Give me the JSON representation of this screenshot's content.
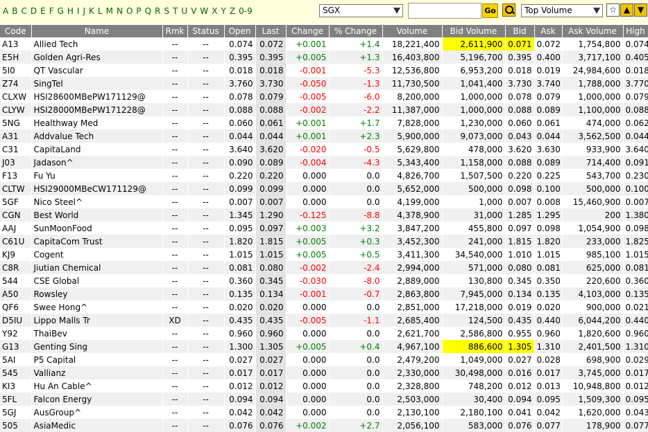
{
  "letters": [
    "A",
    "B",
    "C",
    "D",
    "E",
    "F",
    "G",
    "H",
    "I",
    "J",
    "K",
    "L",
    "M",
    "N",
    "O",
    "P",
    "Q",
    "R",
    "S",
    "T",
    "U",
    "V",
    "W",
    "X",
    "Y",
    "Z",
    "0-9"
  ],
  "exchange": "SGX",
  "search_value": "",
  "go_label": "Go",
  "sort_select": "Top Volume",
  "colors": {
    "header_bg": "#808080",
    "up": "#008000",
    "down": "#ff0000",
    "highlight": "#ffff00",
    "topbar_bg": "#ffffdd"
  },
  "columns": [
    "Code",
    "Name",
    "Rmk",
    "Status",
    "Open",
    "Last",
    "Change",
    "% Change",
    "Volume",
    "Bid Volume",
    "Bid",
    "Ask",
    "Ask Volume",
    "High"
  ],
  "rows": [
    {
      "code": "A13",
      "name": "Allied Tech",
      "rmk": "--",
      "status": "--",
      "open": "0.074",
      "last": "0.072",
      "change": "+0.001",
      "pct": "+1.4",
      "volume": "18,221,400",
      "bidvol": "2,611,900",
      "bid": "0.071",
      "ask": "0.072",
      "askvol": "1,754,800",
      "high": "0.074",
      "dir": "up",
      "hl": true
    },
    {
      "code": "E5H",
      "name": "Golden Agri-Res",
      "rmk": "--",
      "status": "--",
      "open": "0.395",
      "last": "0.395",
      "change": "+0.005",
      "pct": "+1.3",
      "volume": "16,403,800",
      "bidvol": "5,196,700",
      "bid": "0.395",
      "ask": "0.400",
      "askvol": "3,717,100",
      "high": "0.405",
      "dir": "up",
      "hl": false
    },
    {
      "code": "5I0",
      "name": "QT Vascular",
      "rmk": "--",
      "status": "--",
      "open": "0.018",
      "last": "0.018",
      "change": "-0.001",
      "pct": "-5.3",
      "volume": "12,536,800",
      "bidvol": "6,953,200",
      "bid": "0.018",
      "ask": "0.019",
      "askvol": "24,984,600",
      "high": "0.018",
      "dir": "dn",
      "hl": false
    },
    {
      "code": "Z74",
      "name": "SingTel",
      "rmk": "--",
      "status": "--",
      "open": "3.760",
      "last": "3.730",
      "change": "-0.050",
      "pct": "-1.3",
      "volume": "11,730,500",
      "bidvol": "1,041,400",
      "bid": "3.730",
      "ask": "3.740",
      "askvol": "1,788,000",
      "high": "3.770",
      "dir": "dn",
      "hl": false
    },
    {
      "code": "CLXW",
      "name": "HSI28600MBePW171129@",
      "rmk": "--",
      "status": "--",
      "open": "0.078",
      "last": "0.079",
      "change": "-0.005",
      "pct": "-6.0",
      "volume": "8,200,000",
      "bidvol": "1,000,000",
      "bid": "0.078",
      "ask": "0.079",
      "askvol": "1,000,000",
      "high": "0.079",
      "dir": "dn",
      "hl": false
    },
    {
      "code": "CLYW",
      "name": "HSI28000MBePW171228@",
      "rmk": "--",
      "status": "--",
      "open": "0.088",
      "last": "0.088",
      "change": "-0.002",
      "pct": "-2.2",
      "volume": "11,387,000",
      "bidvol": "1,000,000",
      "bid": "0.088",
      "ask": "0.089",
      "askvol": "1,100,000",
      "high": "0.088",
      "dir": "dn",
      "hl": false
    },
    {
      "code": "5NG",
      "name": "Healthway Med",
      "rmk": "--",
      "status": "--",
      "open": "0.060",
      "last": "0.061",
      "change": "+0.001",
      "pct": "+1.7",
      "volume": "7,828,000",
      "bidvol": "1,230,000",
      "bid": "0.060",
      "ask": "0.061",
      "askvol": "474,000",
      "high": "0.062",
      "dir": "up",
      "hl": false
    },
    {
      "code": "A31",
      "name": "Addvalue Tech",
      "rmk": "--",
      "status": "--",
      "open": "0.044",
      "last": "0.044",
      "change": "+0.001",
      "pct": "+2.3",
      "volume": "5,900,000",
      "bidvol": "9,073,000",
      "bid": "0.043",
      "ask": "0.044",
      "askvol": "3,562,500",
      "high": "0.044",
      "dir": "up",
      "hl": false
    },
    {
      "code": "C31",
      "name": "CapitaLand",
      "rmk": "--",
      "status": "--",
      "open": "3.640",
      "last": "3.620",
      "change": "-0.020",
      "pct": "-0.5",
      "volume": "5,629,800",
      "bidvol": "478,000",
      "bid": "3.620",
      "ask": "3.630",
      "askvol": "933,900",
      "high": "3.640",
      "dir": "dn",
      "hl": false
    },
    {
      "code": "J03",
      "name": "Jadason^",
      "rmk": "--",
      "status": "--",
      "open": "0.090",
      "last": "0.089",
      "change": "-0.004",
      "pct": "-4.3",
      "volume": "5,343,400",
      "bidvol": "1,158,000",
      "bid": "0.088",
      "ask": "0.089",
      "askvol": "714,400",
      "high": "0.091",
      "dir": "dn",
      "hl": false
    },
    {
      "code": "F13",
      "name": "Fu Yu",
      "rmk": "--",
      "status": "--",
      "open": "0.220",
      "last": "0.220",
      "change": "0.000",
      "pct": "0.0",
      "volume": "4,826,700",
      "bidvol": "1,507,500",
      "bid": "0.220",
      "ask": "0.225",
      "askvol": "543,700",
      "high": "0.230",
      "dir": "nc",
      "hl": false
    },
    {
      "code": "CLTW",
      "name": "HSI29000MBeCW171129@",
      "rmk": "--",
      "status": "--",
      "open": "0.099",
      "last": "0.099",
      "change": "0.000",
      "pct": "0.0",
      "volume": "5,652,000",
      "bidvol": "500,000",
      "bid": "0.098",
      "ask": "0.100",
      "askvol": "500,000",
      "high": "0.100",
      "dir": "nc",
      "hl": false
    },
    {
      "code": "5GF",
      "name": "Nico Steel^",
      "rmk": "--",
      "status": "--",
      "open": "0.007",
      "last": "0.007",
      "change": "0.000",
      "pct": "0.0",
      "volume": "4,199,000",
      "bidvol": "1,000",
      "bid": "0.007",
      "ask": "0.008",
      "askvol": "15,460,900",
      "high": "0.007",
      "dir": "nc",
      "hl": false
    },
    {
      "code": "CGN",
      "name": "Best World",
      "rmk": "--",
      "status": "--",
      "open": "1.345",
      "last": "1.290",
      "change": "-0.125",
      "pct": "-8.8",
      "volume": "4,378,900",
      "bidvol": "31,000",
      "bid": "1.285",
      "ask": "1.295",
      "askvol": "200",
      "high": "1.380",
      "dir": "dn",
      "hl": false
    },
    {
      "code": "AAJ",
      "name": "SunMoonFood",
      "rmk": "--",
      "status": "--",
      "open": "0.095",
      "last": "0.097",
      "change": "+0.003",
      "pct": "+3.2",
      "volume": "3,847,200",
      "bidvol": "455,800",
      "bid": "0.097",
      "ask": "0.098",
      "askvol": "1,054,900",
      "high": "0.098",
      "dir": "up",
      "hl": false
    },
    {
      "code": "C61U",
      "name": "CapitaCom Trust",
      "rmk": "--",
      "status": "--",
      "open": "1.820",
      "last": "1.815",
      "change": "+0.005",
      "pct": "+0.3",
      "volume": "3,452,300",
      "bidvol": "241,000",
      "bid": "1.815",
      "ask": "1.820",
      "askvol": "233,000",
      "high": "1.825",
      "dir": "up",
      "hl": false
    },
    {
      "code": "KJ9",
      "name": "Cogent",
      "rmk": "--",
      "status": "--",
      "open": "1.015",
      "last": "1.015",
      "change": "+0.005",
      "pct": "+0.5",
      "volume": "3,411,300",
      "bidvol": "34,540,000",
      "bid": "1.010",
      "ask": "1.015",
      "askvol": "985,100",
      "high": "1.015",
      "dir": "up",
      "hl": false
    },
    {
      "code": "C8R",
      "name": "Jiutian Chemical",
      "rmk": "--",
      "status": "--",
      "open": "0.081",
      "last": "0.080",
      "change": "-0.002",
      "pct": "-2.4",
      "volume": "2,994,000",
      "bidvol": "571,000",
      "bid": "0.080",
      "ask": "0.081",
      "askvol": "625,000",
      "high": "0.081",
      "dir": "dn",
      "hl": false
    },
    {
      "code": "544",
      "name": "CSE Global",
      "rmk": "--",
      "status": "--",
      "open": "0.360",
      "last": "0.345",
      "change": "-0.030",
      "pct": "-8.0",
      "volume": "2,889,000",
      "bidvol": "130,800",
      "bid": "0.345",
      "ask": "0.350",
      "askvol": "220,600",
      "high": "0.360",
      "dir": "dn",
      "hl": false
    },
    {
      "code": "A50",
      "name": "Rowsley",
      "rmk": "--",
      "status": "--",
      "open": "0.135",
      "last": "0.134",
      "change": "-0.001",
      "pct": "-0.7",
      "volume": "2,863,800",
      "bidvol": "7,945,000",
      "bid": "0.134",
      "ask": "0.135",
      "askvol": "4,103,000",
      "high": "0.135",
      "dir": "dn",
      "hl": false
    },
    {
      "code": "QF6",
      "name": "Swee Hong^",
      "rmk": "--",
      "status": "--",
      "open": "0.020",
      "last": "0.020",
      "change": "0.000",
      "pct": "0.0",
      "volume": "2,851,000",
      "bidvol": "17,218,000",
      "bid": "0.019",
      "ask": "0.020",
      "askvol": "900,000",
      "high": "0.021",
      "dir": "nc",
      "hl": false
    },
    {
      "code": "D5IU",
      "name": "Lippo Malls Tr",
      "rmk": "XD",
      "status": "--",
      "open": "0.435",
      "last": "0.435",
      "change": "-0.005",
      "pct": "-1.1",
      "volume": "2,685,400",
      "bidvol": "124,500",
      "bid": "0.435",
      "ask": "0.440",
      "askvol": "6,044,200",
      "high": "0.440",
      "dir": "dn",
      "hl": false
    },
    {
      "code": "Y92",
      "name": "ThaiBev",
      "rmk": "--",
      "status": "--",
      "open": "0.960",
      "last": "0.960",
      "change": "0.000",
      "pct": "0.0",
      "volume": "2,621,700",
      "bidvol": "2,586,800",
      "bid": "0.955",
      "ask": "0.960",
      "askvol": "1,820,600",
      "high": "0.960",
      "dir": "nc",
      "hl": false
    },
    {
      "code": "G13",
      "name": "Genting Sing",
      "rmk": "--",
      "status": "--",
      "open": "1.300",
      "last": "1.305",
      "change": "+0.005",
      "pct": "+0.4",
      "volume": "4,967,100",
      "bidvol": "886,600",
      "bid": "1.305",
      "ask": "1.310",
      "askvol": "2,401,500",
      "high": "1.310",
      "dir": "up",
      "hl": true
    },
    {
      "code": "5AI",
      "name": "P5 Capital",
      "rmk": "--",
      "status": "--",
      "open": "0.027",
      "last": "0.027",
      "change": "0.000",
      "pct": "0.0",
      "volume": "2,479,200",
      "bidvol": "1,049,000",
      "bid": "0.027",
      "ask": "0.028",
      "askvol": "698,900",
      "high": "0.029",
      "dir": "nc",
      "hl": false
    },
    {
      "code": "545",
      "name": "Vallianz",
      "rmk": "--",
      "status": "--",
      "open": "0.017",
      "last": "0.017",
      "change": "0.000",
      "pct": "0.0",
      "volume": "2,330,000",
      "bidvol": "30,498,000",
      "bid": "0.016",
      "ask": "0.017",
      "askvol": "3,745,000",
      "high": "0.017",
      "dir": "nc",
      "hl": false
    },
    {
      "code": "KI3",
      "name": "Hu An Cable^",
      "rmk": "--",
      "status": "--",
      "open": "0.012",
      "last": "0.012",
      "change": "0.000",
      "pct": "0.0",
      "volume": "2,328,800",
      "bidvol": "748,200",
      "bid": "0.012",
      "ask": "0.013",
      "askvol": "10,948,800",
      "high": "0.012",
      "dir": "nc",
      "hl": false
    },
    {
      "code": "5FL",
      "name": "Falcon Energy",
      "rmk": "--",
      "status": "--",
      "open": "0.094",
      "last": "0.094",
      "change": "0.000",
      "pct": "0.0",
      "volume": "2,503,000",
      "bidvol": "30,400",
      "bid": "0.094",
      "ask": "0.095",
      "askvol": "1,509,300",
      "high": "0.095",
      "dir": "nc",
      "hl": false
    },
    {
      "code": "5GJ",
      "name": "AusGroup^",
      "rmk": "--",
      "status": "--",
      "open": "0.042",
      "last": "0.042",
      "change": "0.000",
      "pct": "0.0",
      "volume": "2,130,100",
      "bidvol": "2,180,100",
      "bid": "0.041",
      "ask": "0.042",
      "askvol": "1,620,000",
      "high": "0.043",
      "dir": "nc",
      "hl": false
    },
    {
      "code": "505",
      "name": "AsiaMedic",
      "rmk": "--",
      "status": "--",
      "open": "0.076",
      "last": "0.076",
      "change": "+0.002",
      "pct": "+2.7",
      "volume": "2,056,100",
      "bidvol": "583,000",
      "bid": "0.076",
      "ask": "0.077",
      "askvol": "178,900",
      "high": "0.077",
      "dir": "up",
      "hl": false
    }
  ]
}
